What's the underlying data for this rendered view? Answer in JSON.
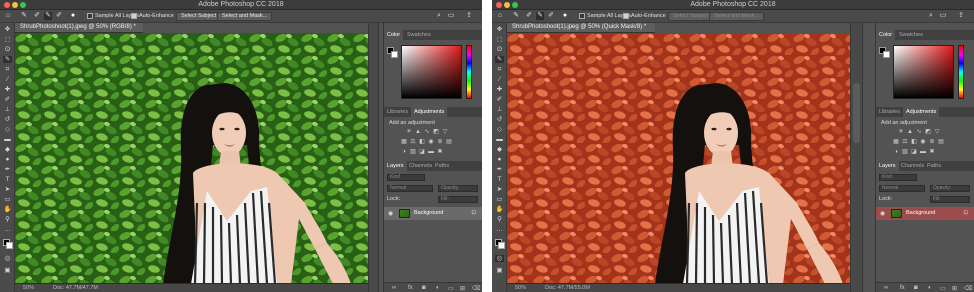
{
  "app_title": "Adobe Photoshop CC 2018",
  "options_bar": {
    "sample_all_layers_label": "Sample All Layers",
    "auto_enhance_label": "Auto-Enhance",
    "select_subject_label": "Select Subject",
    "select_and_mask_label": "Select and Mask..."
  },
  "left_window": {
    "doc_tab": "ShrubPhotoshoot(1).jpeg @ 50% (RGB/8) *",
    "zoom": "50%",
    "doc_info": "Doc: 47.7M/47.7M"
  },
  "right_window": {
    "doc_tab": "ShrubPhotoshoot(1).jpeg @ 50% (Quick Mask/8) *",
    "zoom": "50%",
    "doc_info": "Doc: 47.7M/55.0M"
  },
  "panels": {
    "color_tabs": [
      "Color",
      "Swatches"
    ],
    "adjust_tabs": [
      "Libraries",
      "Adjustments"
    ],
    "add_adjustment_label": "Add an adjustment",
    "layers_tabs": [
      "Layers",
      "Channels",
      "Paths"
    ],
    "kind_placeholder": "Kind",
    "blend_mode": "Normal",
    "opacity_label": "Opacity:",
    "lock_label": "Lock:",
    "fill_label": "Fill:",
    "background_layer_name": "Background"
  },
  "colors": {
    "ui_dark": "#535353",
    "foliage_green": "#3d7f22",
    "quick_mask_red": "#c64527",
    "traffic_red": "#fc605c",
    "traffic_yellow": "#fdbc40",
    "traffic_green": "#34c84a"
  },
  "icons": {
    "tools": [
      "move-icon",
      "marquee-icon",
      "lasso-icon",
      "quick-select-icon",
      "crop-icon",
      "eyedropper-icon",
      "healing-icon",
      "brush-icon",
      "stamp-icon",
      "history-brush-icon",
      "eraser-icon",
      "gradient-icon",
      "blur-icon",
      "dodge-icon",
      "pen-icon",
      "type-icon",
      "path-select-icon",
      "shape-icon",
      "hand-icon",
      "zoom-icon"
    ]
  }
}
